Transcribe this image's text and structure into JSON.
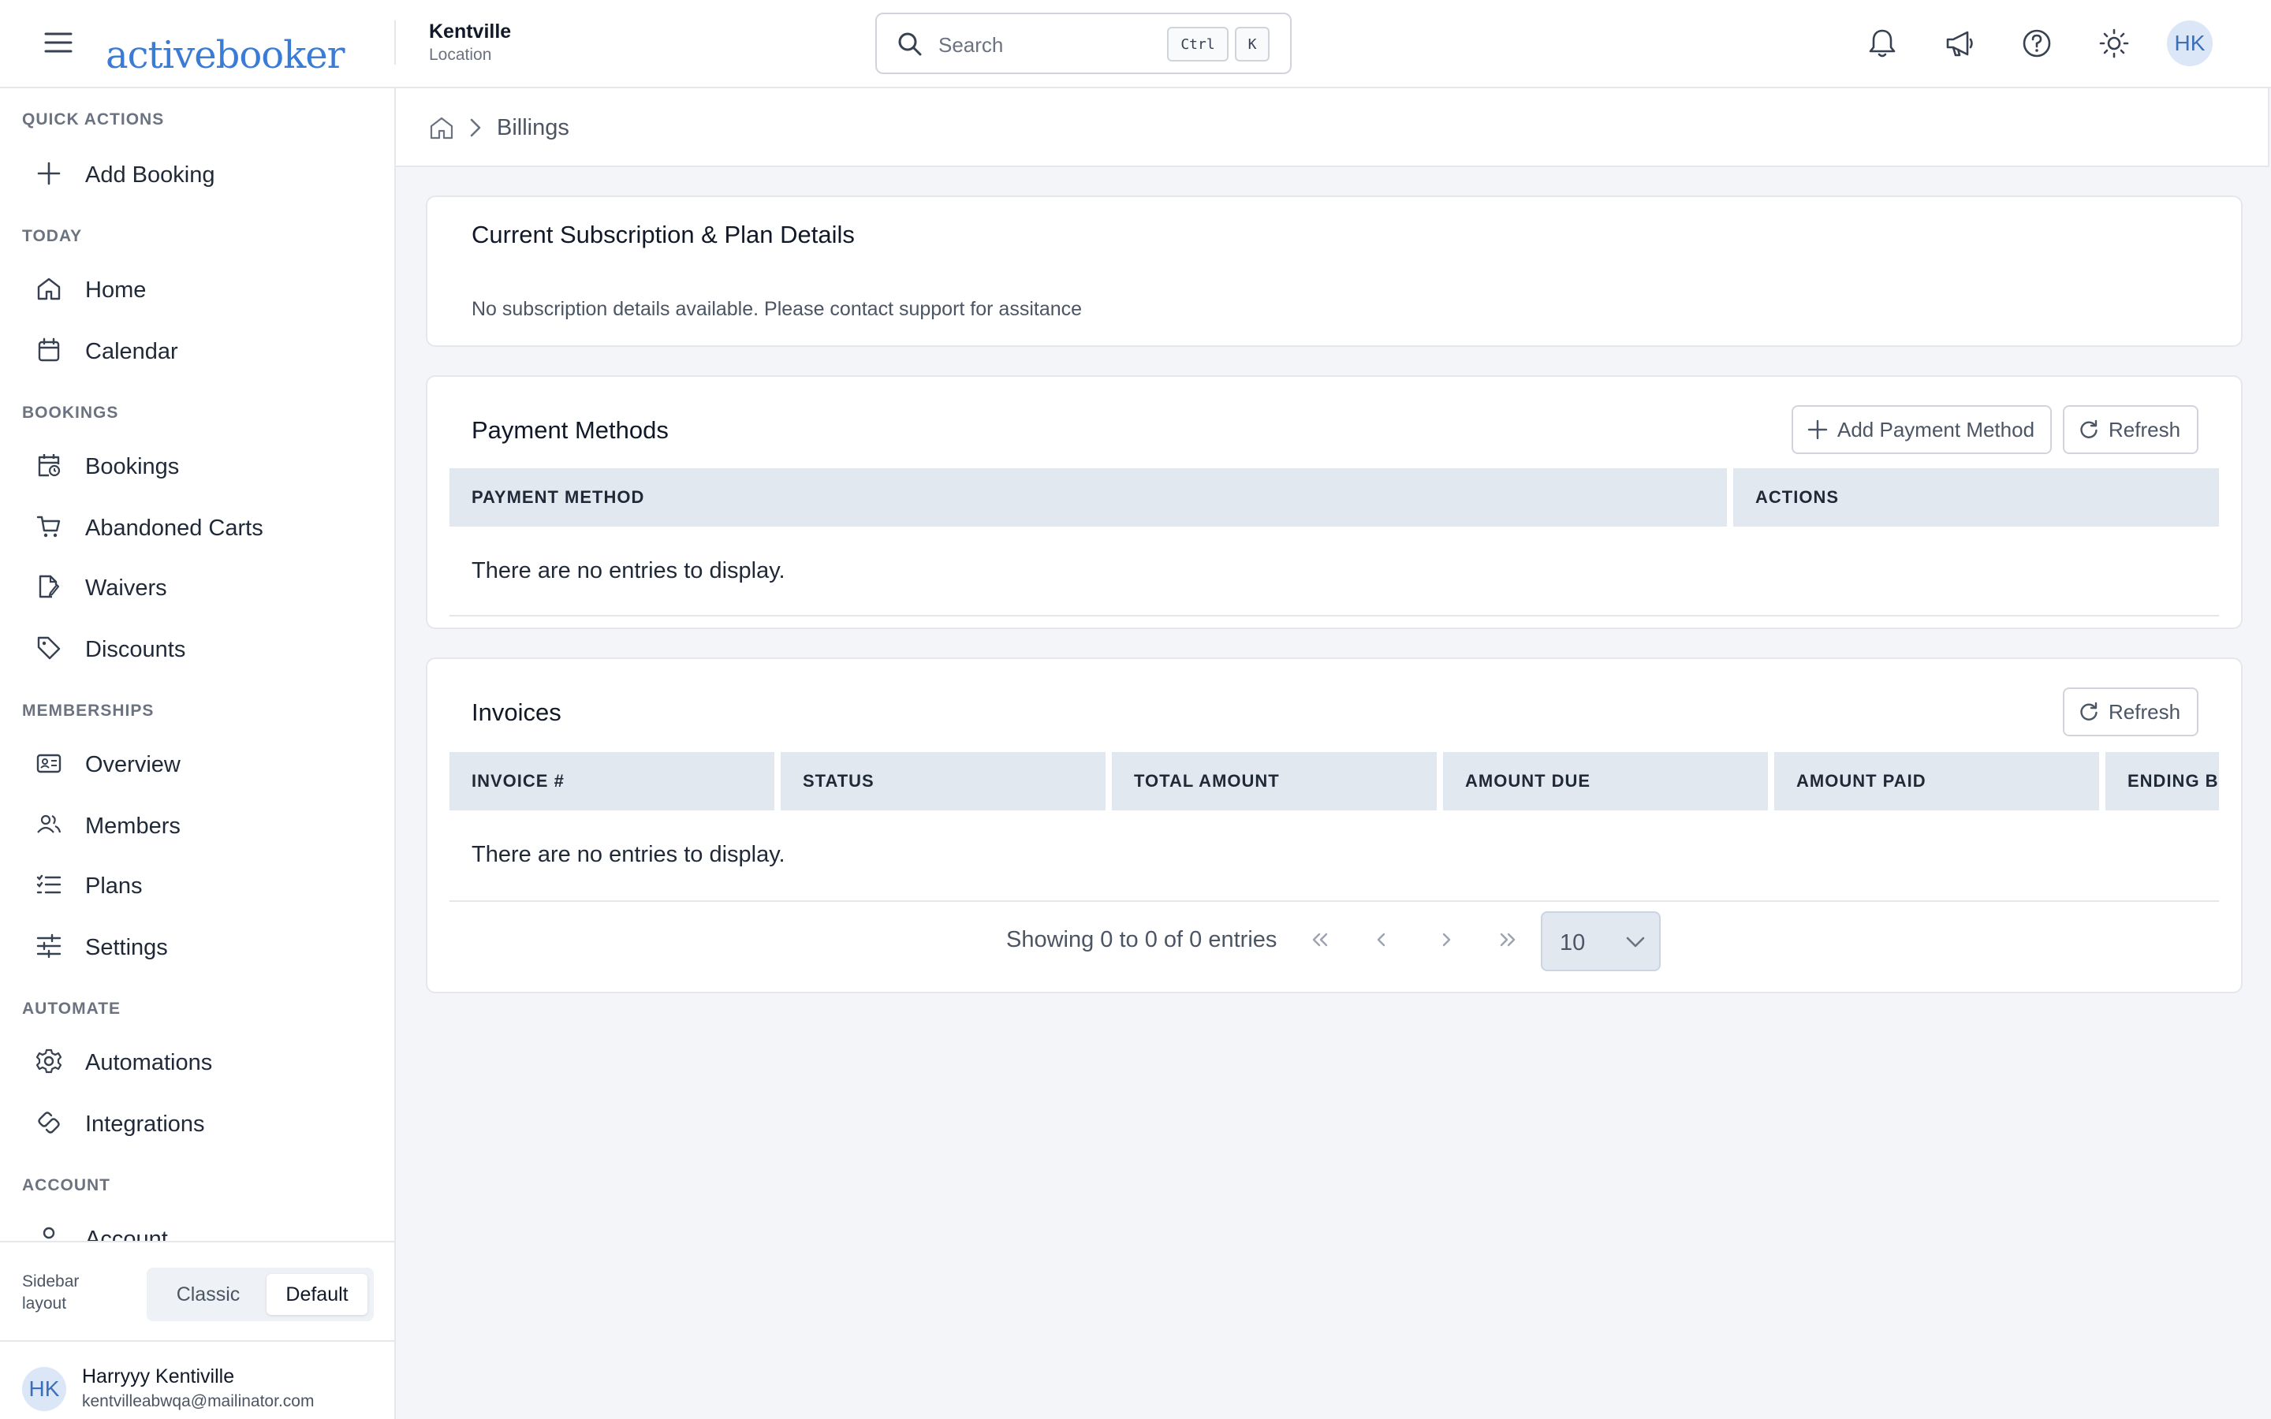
{
  "app": {
    "logo_text": "activebooker"
  },
  "location": {
    "name": "Kentville",
    "label": "Location"
  },
  "search": {
    "placeholder": "Search",
    "shortcut_ctrl": "Ctrl",
    "shortcut_key": "K"
  },
  "user": {
    "initials": "HK",
    "name": "Harryyy Kentiville",
    "email": "kentvilleabwqa@mailinator.com"
  },
  "sidebar": {
    "sections": {
      "quick_actions": "QUICK ACTIONS",
      "today": "TODAY",
      "bookings": "BOOKINGS",
      "memberships": "MEMBERSHIPS",
      "automate": "AUTOMATE",
      "account": "ACCOUNT"
    },
    "items": {
      "add_booking": "Add Booking",
      "home": "Home",
      "calendar": "Calendar",
      "bookings": "Bookings",
      "abandoned_carts": "Abandoned Carts",
      "waivers": "Waivers",
      "discounts": "Discounts",
      "overview": "Overview",
      "members": "Members",
      "plans": "Plans",
      "settings": "Settings",
      "automations": "Automations",
      "integrations": "Integrations",
      "account": "Account"
    },
    "layout_label": "Sidebar layout",
    "layout_options": [
      "Classic",
      "Default"
    ],
    "layout_selected": "Default"
  },
  "breadcrumb": {
    "current": "Billings"
  },
  "subscription": {
    "title": "Current Subscription & Plan Details",
    "message": "No subscription details available. Please contact support for assitance"
  },
  "payment_methods": {
    "title": "Payment Methods",
    "add_button": "Add Payment Method",
    "refresh_button": "Refresh",
    "columns": [
      "PAYMENT METHOD",
      "ACTIONS"
    ],
    "empty_text": "There are no entries to display."
  },
  "invoices": {
    "title": "Invoices",
    "refresh_button": "Refresh",
    "columns": [
      "INVOICE #",
      "STATUS",
      "TOTAL AMOUNT",
      "AMOUNT DUE",
      "AMOUNT PAID",
      "ENDING BA"
    ],
    "empty_text": "There are no entries to display.",
    "pagination_text": "Showing 0 to 0 of 0 entries",
    "page_size": "10"
  }
}
